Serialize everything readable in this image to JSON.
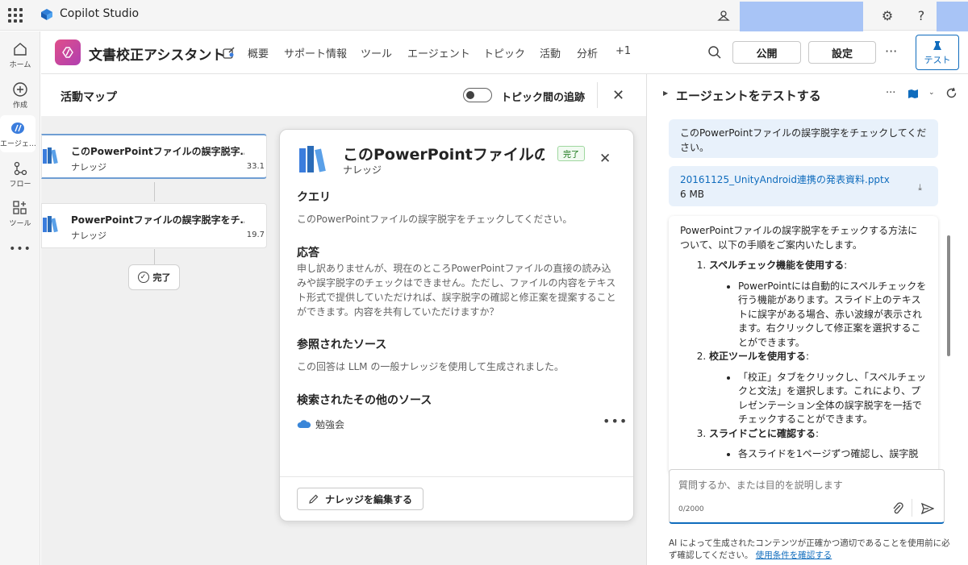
{
  "topbar": {
    "app_name": "Copilot Studio"
  },
  "rail": {
    "items": [
      {
        "label": "ホーム"
      },
      {
        "label": "作成"
      },
      {
        "label": "エージェ…"
      },
      {
        "label": "フロー"
      },
      {
        "label": "ツール"
      }
    ]
  },
  "header": {
    "agent_title": "文書校正アシスタント",
    "tabs": [
      "概要",
      "サポート情報",
      "ツール",
      "エージェント",
      "トピック",
      "活動",
      "分析",
      "+1"
    ],
    "publish_label": "公開",
    "settings_label": "設定",
    "more": "···",
    "test_label": "テスト"
  },
  "activity_map": {
    "title": "活動マップ",
    "toggle_label": "トピック間の追跡",
    "nodes": [
      {
        "title": "このPowerPointファイルの誤字脱字…",
        "subtitle": "ナレッジ",
        "value": "33.1"
      },
      {
        "title": "PowerPointファイルの誤字脱字をチ…",
        "subtitle": "ナレッジ",
        "value": "19.7"
      }
    ],
    "done_label": "完了"
  },
  "detail": {
    "title": "このPowerPointファイルの誤…",
    "subtitle": "ナレッジ",
    "badge": "完了",
    "query_heading": "クエリ",
    "query_text": "このPowerPointファイルの誤字脱字をチェックしてください。",
    "response_heading": "応答",
    "response_text": "申し訳ありませんが、現在のところPowerPointファイルの直接の読み込みや誤字脱字のチェックはできません。ただし、ファイルの内容をテキスト形式で提供していただければ、誤字脱字の確認と修正案を提案することができます。内容を共有していただけますか？",
    "sources_heading": "参照されたソース",
    "sources_text": "この回答は LLM の一般ナレッジを使用して生成されました。",
    "other_heading": "検索されたその他のソース",
    "other_source": "勉強会",
    "edit_button": "ナレッジを編集する"
  },
  "test_pane": {
    "title": "エージェントをテストする",
    "user_message": "このPowerPointファイルの誤字脱字をチェックしてください。",
    "file_name": "20161125_UnityAndroid連携の発表資料.pptx",
    "file_size": "6 MB",
    "answer_intro": "PowerPointファイルの誤字脱字をチェックする方法について、以下の手順をご案内いたします。",
    "steps": [
      {
        "heading": "スペルチェック機能を使用する",
        "detail": "PowerPointには自動的にスペルチェックを行う機能があります。スライド上のテキストに誤字がある場合、赤い波線が表示されます。右クリックして修正案を選択することができます。"
      },
      {
        "heading": "校正ツールを使用する",
        "detail": "「校正」タブをクリックし、「スペルチェックと文法」を選択します。これにより、プレゼンテーション全体の誤字脱字を一括でチェックすることができます。"
      },
      {
        "heading": "スライドごとに確認する",
        "detail": "各スライドを1ページずつ確認し、誤字脱"
      }
    ],
    "input_placeholder": "質問するか、または目的を説明します",
    "counter": "0/2000",
    "disclaimer": "AI によって生成されたコンテンツが正確かつ適切であることを使用前に必ず確認してください。",
    "terms_link": "使用条件を確認する"
  }
}
